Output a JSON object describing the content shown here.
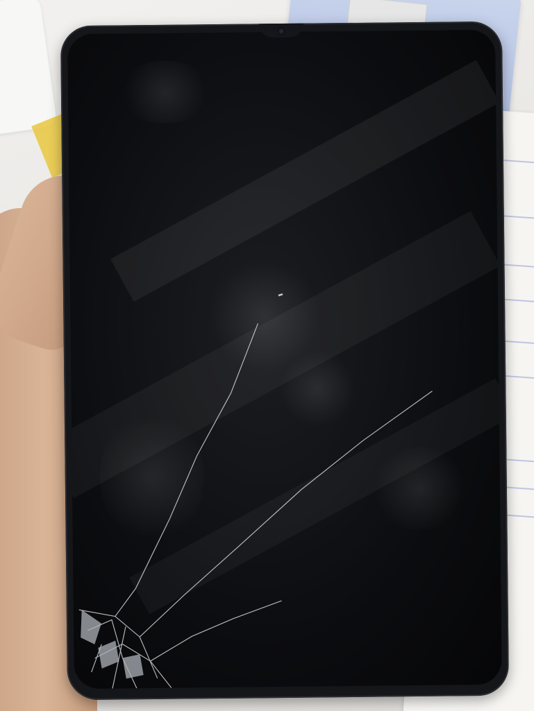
{
  "scene": {
    "kind": "photo",
    "device": "smartphone",
    "screen_state": "off",
    "damage": "cracked-lower-left-corner"
  },
  "colors": {
    "phone_body": "#15161a",
    "screen": "#0c0d10",
    "skin": "#d9b497",
    "desk": "#e9e8e6",
    "box_blue": "#aebde2"
  }
}
